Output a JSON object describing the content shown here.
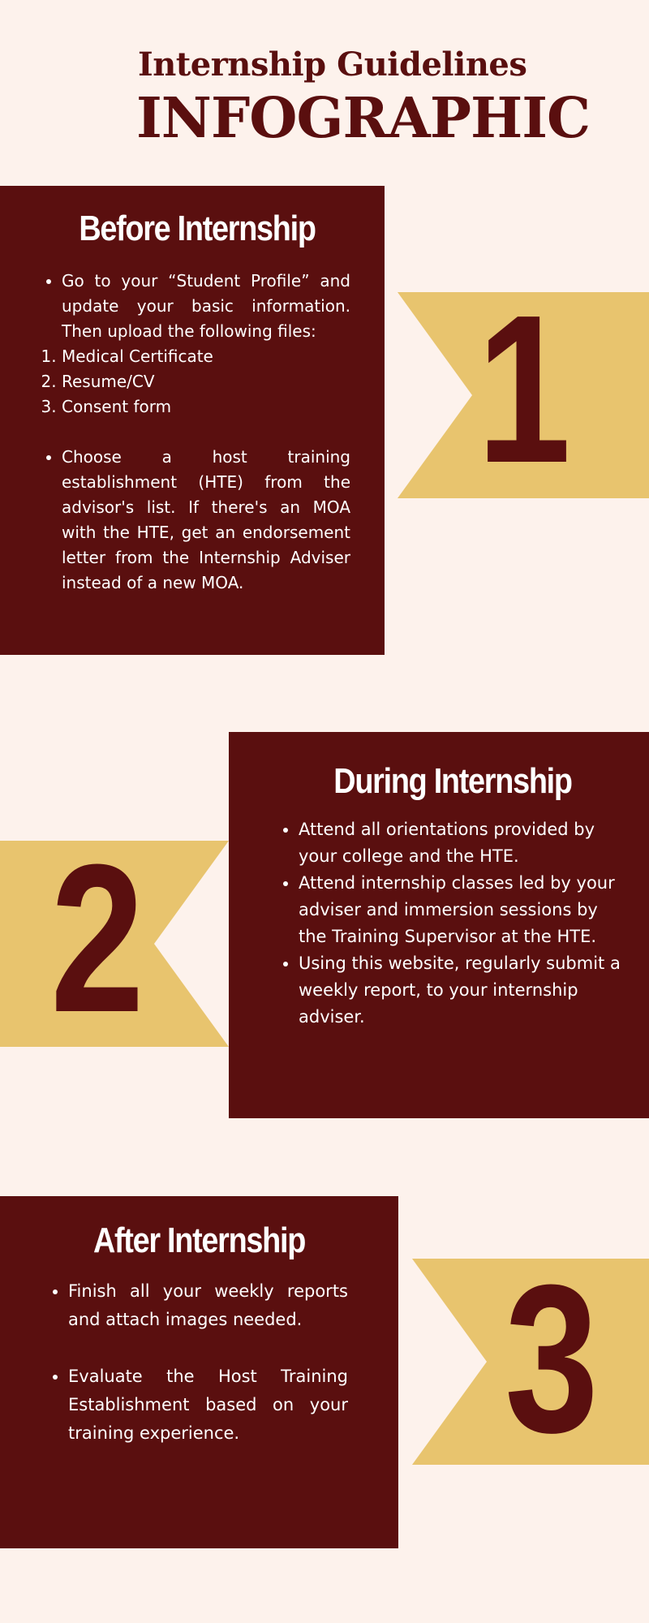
{
  "header": {
    "subtitle": "Internship Guidelines",
    "title": "INFOGRAPHIC"
  },
  "colors": {
    "background": "#fdf2ec",
    "panel": "#5a0f0f",
    "ribbon": "#e8c46e",
    "text": "#ffffff"
  },
  "sections": [
    {
      "number": "1",
      "heading": "Before Internship",
      "intro": "Go to your “Student Profile” and update your basic information. Then upload the following files:",
      "files": [
        "Medical Certificate",
        "Resume/CV",
        "Consent form"
      ],
      "bullet2": "Choose a host training establishment (HTE) from the advisor's list. If there's an MOA with the HTE, get an endorsement letter from the Internship Adviser instead of a new MOA."
    },
    {
      "number": "2",
      "heading": "During Internship",
      "bullets": [
        "Attend all orientations provided by your college and the HTE.",
        "Attend internship classes led by your adviser and immersion sessions by the Training Supervisor at the HTE.",
        "Using this website, regularly submit a weekly report, to your internship adviser."
      ]
    },
    {
      "number": "3",
      "heading": "After Internship",
      "bullets": [
        "Finish all your weekly reports and attach images needed.",
        "Evaluate the Host Training Establishment based on your training experience."
      ]
    }
  ]
}
